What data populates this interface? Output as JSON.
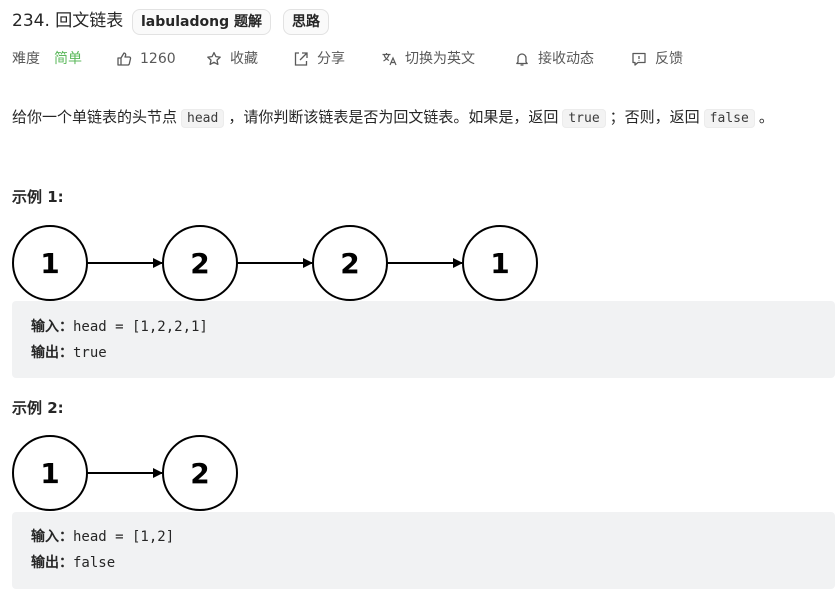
{
  "header": {
    "title": "234. 回文链表",
    "tags": [
      "labuladong 题解",
      "思路"
    ]
  },
  "meta": {
    "difficulty_label": "难度",
    "difficulty_value": "简单",
    "likes": "1260",
    "favorite": "收藏",
    "share": "分享",
    "translate": "切换为英文",
    "notify": "接收动态",
    "feedback": "反馈"
  },
  "description": {
    "p1": "给你一个单链表的头节点",
    "code_head": "head",
    "p2": "，请你判断该链表是否为回文链表。如果是，返回",
    "code_true": "true",
    "p3": "；否则，返回",
    "code_false": "false",
    "p4": "。"
  },
  "examples": [
    {
      "heading": "示例 1:",
      "nodes": [
        "1",
        "2",
        "2",
        "1"
      ],
      "input_label": "输入：",
      "input_value": "head = [1,2,2,1]",
      "output_label": "输出：",
      "output_value": "true"
    },
    {
      "heading": "示例 2:",
      "nodes": [
        "1",
        "2"
      ],
      "input_label": "输入：",
      "input_value": "head = [1,2]",
      "output_label": "输出：",
      "output_value": "false"
    }
  ],
  "colors": {
    "easy": "#5cb85c",
    "code_bg": "#f1f2f3",
    "text": "#262626",
    "muted": "#595959"
  },
  "icons": [
    "thumbs-up-icon",
    "star-icon",
    "share-icon",
    "translate-icon",
    "bell-icon",
    "feedback-icon"
  ]
}
